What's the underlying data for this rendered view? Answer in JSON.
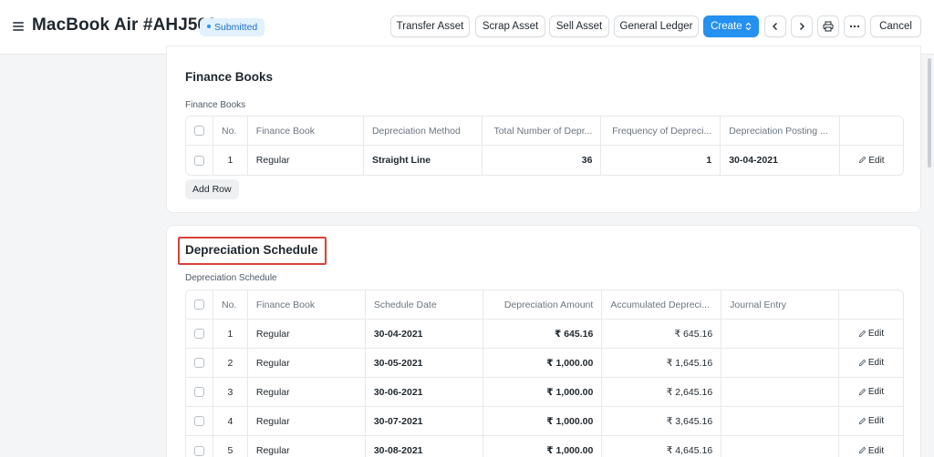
{
  "header": {
    "title": "MacBook Air #AHJ569",
    "status": "Submitted",
    "buttons": {
      "transfer": "Transfer Asset",
      "scrap": "Scrap Asset",
      "sell": "Sell Asset",
      "ledger": "General Ledger",
      "create": "Create",
      "cancel": "Cancel"
    }
  },
  "finance_books": {
    "section_title": "Finance Books",
    "table_label": "Finance Books",
    "columns": [
      "No.",
      "Finance Book",
      "Depreciation Method",
      "Total Number of Depr...",
      "Frequency of Depreci...",
      "Depreciation Posting ..."
    ],
    "rows": [
      {
        "no": "1",
        "finance_book": "Regular",
        "method": "Straight Line",
        "total": "36",
        "frequency": "1",
        "posting": "30-04-2021"
      }
    ],
    "add_row": "Add Row",
    "edit_label": "Edit"
  },
  "depreciation_schedule": {
    "section_title": "Depreciation Schedule",
    "table_label": "Depreciation Schedule",
    "columns": [
      "No.",
      "Finance Book",
      "Schedule Date",
      "Depreciation Amount",
      "Accumulated Depreci...",
      "Journal Entry"
    ],
    "rows": [
      {
        "no": "1",
        "finance_book": "Regular",
        "date": "30-04-2021",
        "amount": "₹ 645.16",
        "accumulated": "₹ 645.16",
        "journal": ""
      },
      {
        "no": "2",
        "finance_book": "Regular",
        "date": "30-05-2021",
        "amount": "₹ 1,000.00",
        "accumulated": "₹ 1,645.16",
        "journal": ""
      },
      {
        "no": "3",
        "finance_book": "Regular",
        "date": "30-06-2021",
        "amount": "₹ 1,000.00",
        "accumulated": "₹ 2,645.16",
        "journal": ""
      },
      {
        "no": "4",
        "finance_book": "Regular",
        "date": "30-07-2021",
        "amount": "₹ 1,000.00",
        "accumulated": "₹ 3,645.16",
        "journal": ""
      },
      {
        "no": "5",
        "finance_book": "Regular",
        "date": "30-08-2021",
        "amount": "₹ 1,000.00",
        "accumulated": "₹ 4,645.16",
        "journal": ""
      }
    ],
    "edit_label": "Edit"
  },
  "colors": {
    "primary": "#2490ef",
    "badge_bg": "#e2f1fd",
    "highlight": "#d9413a"
  }
}
